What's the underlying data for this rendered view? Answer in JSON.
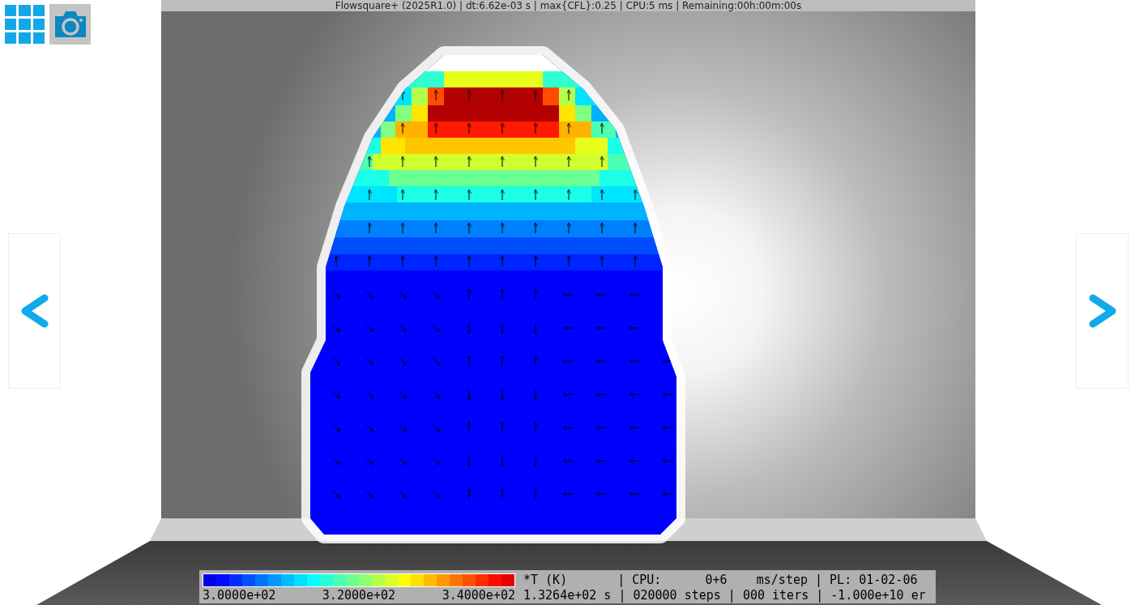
{
  "title_bar": "Flowsquare+ (2025R1.0) | dt:6.62e-03 s | max{CFL}:0.25 | CPU:5 ms | Remaining:00h:00m:00s",
  "legend": {
    "variable": "*T (K)",
    "cpu_info": "| CPU:      0+6    ms/step | PL: 01-02-06",
    "ticks": [
      "3.0000e+02",
      "3.2000e+02",
      "3.4000e+02"
    ],
    "run_info": "1.3264e+02 s | 020000 steps | 000 iters | -1.000e+10 er"
  }
}
